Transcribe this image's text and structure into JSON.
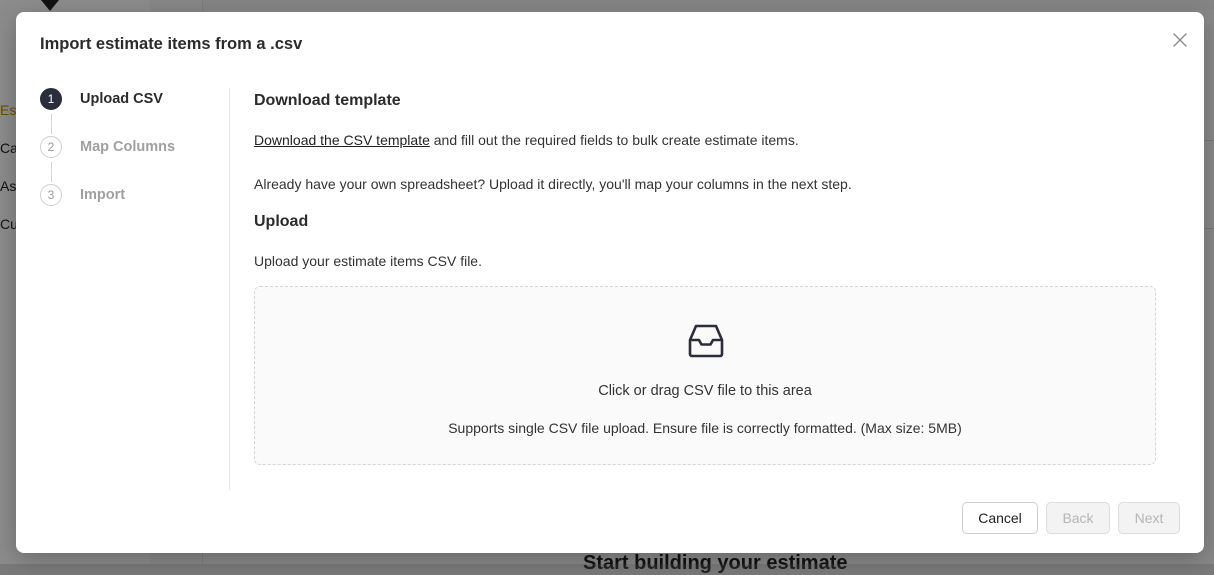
{
  "background_app": {
    "sidebar_items": [
      {
        "label": "Es",
        "active": true
      },
      {
        "label": "Ca",
        "active": false
      },
      {
        "label": "As",
        "active": false
      },
      {
        "label": "Cu",
        "active": false
      }
    ],
    "main_heading": "Start building your estimate"
  },
  "modal": {
    "title": "Import estimate items from a .csv",
    "close_icon": "close-icon",
    "steps": [
      {
        "number": "1",
        "label": "Upload CSV",
        "state": "active"
      },
      {
        "number": "2",
        "label": "Map Columns",
        "state": "pending"
      },
      {
        "number": "3",
        "label": "Import",
        "state": "pending"
      }
    ],
    "download": {
      "title": "Download template",
      "link_text": "Download the CSV template",
      "link_suffix": " and fill out the required fields to bulk create estimate items.",
      "own_sheet_text": "Already have your own spreadsheet? Upload it directly, you'll map your columns in the next step."
    },
    "upload": {
      "title": "Upload",
      "description": "Upload your estimate items CSV file.",
      "dropzone_icon": "inbox-icon",
      "dropzone_text": "Click or drag CSV file to this area",
      "dropzone_hint": "Supports single CSV file upload. Ensure file is correctly formatted. (Max size: 5MB)"
    },
    "footer": {
      "cancel_label": "Cancel",
      "back_label": "Back",
      "next_label": "Next"
    }
  },
  "colors": {
    "accent_dark": "#2b2d3a",
    "active_sidebar": "#c98a00",
    "overlay": "rgba(0,0,0,0.45)"
  }
}
